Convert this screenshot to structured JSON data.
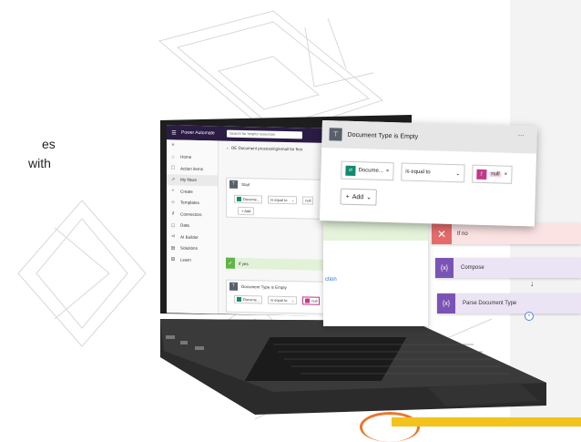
{
  "left_text": {
    "line1": "es",
    "line2": "with"
  },
  "laptop_screen": {
    "topbar": {
      "brand": "Power Automate",
      "search_placeholder": "Search for helpful resources"
    },
    "breadcrumb": "OE Document processing/email for first",
    "nav": [
      {
        "icon": "home-icon",
        "glyph": "⌂",
        "label": "Home"
      },
      {
        "icon": "action-items-icon",
        "glyph": "☐",
        "label": "Action items"
      },
      {
        "icon": "my-flows-icon",
        "glyph": "↗",
        "label": "My flows"
      },
      {
        "icon": "create-icon",
        "glyph": "+",
        "label": "Create"
      },
      {
        "icon": "templates-icon",
        "glyph": "⊹",
        "label": "Templates"
      },
      {
        "icon": "connectors-icon",
        "glyph": "∂",
        "label": "Connectors"
      },
      {
        "icon": "data-icon",
        "glyph": "▢",
        "label": "Data"
      },
      {
        "icon": "ai-builder-icon",
        "glyph": "⊲",
        "label": "AI Builder"
      },
      {
        "icon": "solutions-icon",
        "glyph": "▤",
        "label": "Solutions"
      },
      {
        "icon": "learn-icon",
        "glyph": "▥",
        "label": "Learn"
      }
    ],
    "active_nav_index": 2,
    "card1": {
      "title": "Start",
      "chip": "Docume...",
      "operator": "is equal to",
      "value": "null",
      "add_label": "+ Add"
    },
    "if_yes": "If yes",
    "card2": {
      "title": "Document Type is Empty",
      "chip": "Docume...",
      "operator": "is equal to",
      "value": "null"
    }
  },
  "floating_condition": {
    "title": "Document Type is Empty",
    "dots": "...",
    "chip_label": "Docume...",
    "chip_close": "×",
    "operator": "is equal to",
    "value_label": "null",
    "value_close": "×",
    "add_label": "Add"
  },
  "floating_left": {
    "action_text": "ction"
  },
  "if_no": "If no",
  "compose": "Compose",
  "parse_doc": "Parse Document Type",
  "colors": {
    "topbar": "#2b1c44",
    "if_yes_green": "#5fb548",
    "if_no_red": "#e56b6b",
    "action_purple": "#7a54b5",
    "accent_yellow": "#f2c31b",
    "accent_orange": "#e8772e"
  }
}
